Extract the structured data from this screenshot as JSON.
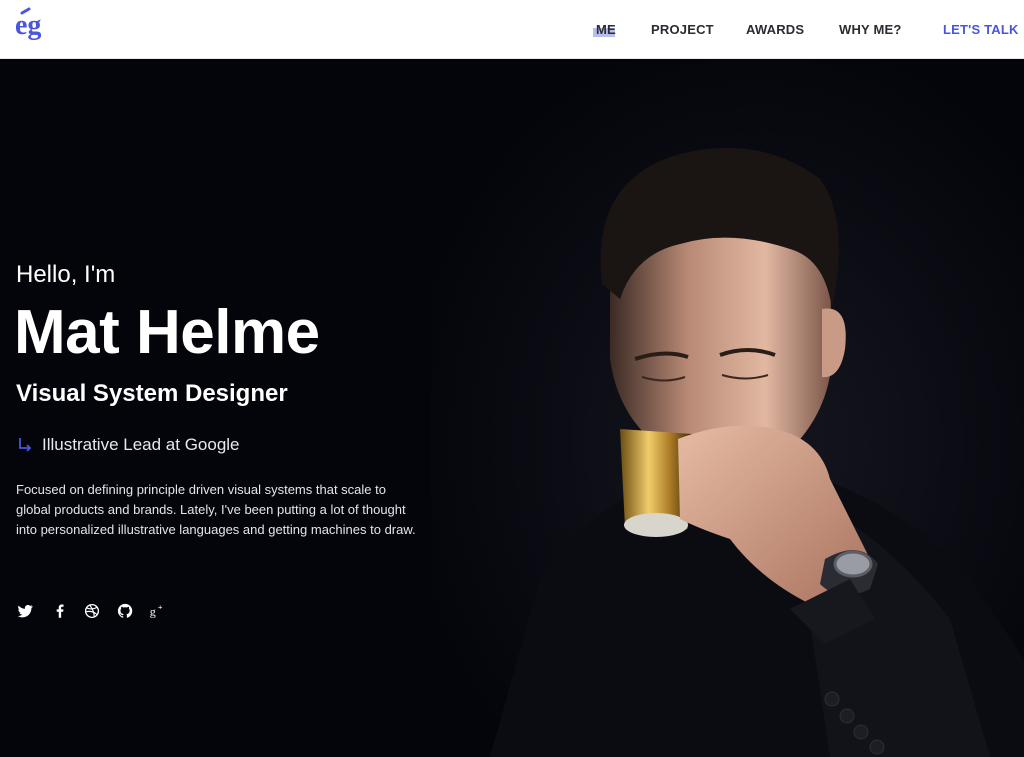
{
  "header": {
    "logo_text": "eg",
    "nav": {
      "me": "ME",
      "project": "PROJECT",
      "awards": "AWARDS",
      "why_me": "WHY ME?",
      "lets_talk": "LET'S TALK"
    }
  },
  "hero": {
    "greeting": "Hello, I'm",
    "name": "Mat Helme",
    "role": "Visual System Designer",
    "lead": "Illustrative Lead at Google",
    "bio": "Focused on defining principle driven visual systems that scale to global products and brands. Lately, I've been putting a lot of thought into personalized illustrative languages and getting machines to draw.",
    "social": [
      "twitter-icon",
      "facebook-icon",
      "dribbble-icon",
      "github-icon",
      "google-plus-icon"
    ]
  },
  "colors": {
    "accent": "#4a55e0",
    "nav_text": "#2b2b33",
    "hero_bg": "#04050b",
    "highlight": "#b8bfec"
  }
}
